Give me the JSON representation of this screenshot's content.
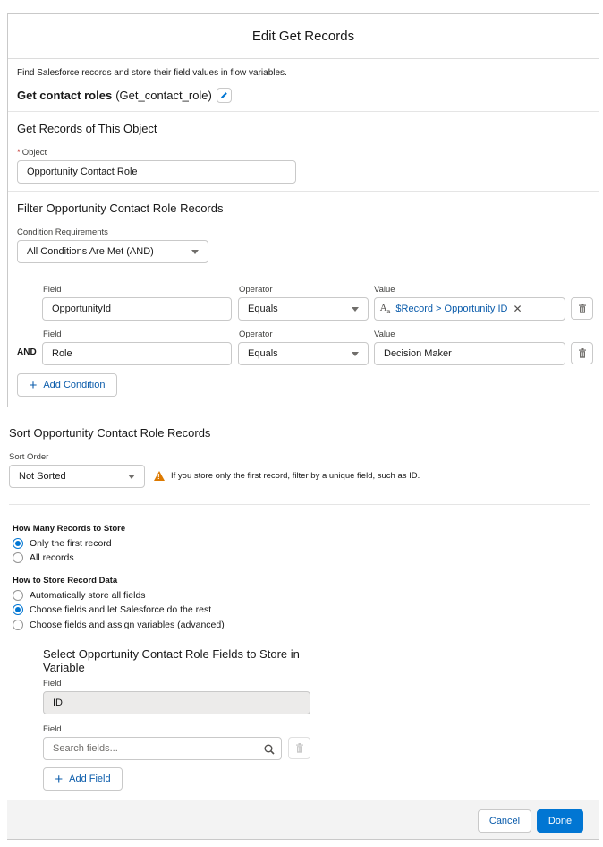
{
  "modal": {
    "title": "Edit Get Records",
    "description": "Find Salesforce records and store their field values in flow variables.",
    "element_label": "Get contact roles",
    "element_api_name": "(Get_contact_role)"
  },
  "object_section": {
    "title": "Get Records of This Object",
    "object_label": "Object",
    "object_value": "Opportunity Contact Role"
  },
  "filter_section": {
    "title": "Filter Opportunity Contact Role Records",
    "condition_requirements_label": "Condition Requirements",
    "condition_requirements_value": "All Conditions Are Met (AND)",
    "conditions": [
      {
        "field_label": "Field",
        "field_value": "OpportunityId",
        "operator_label": "Operator",
        "operator_value": "Equals",
        "value_label": "Value",
        "value_value": "$Record > Opportunity ID",
        "prefix": ""
      },
      {
        "field_label": "Field",
        "field_value": "Role",
        "operator_label": "Operator",
        "operator_value": "Equals",
        "value_label": "Value",
        "value_value": "Decision Maker",
        "prefix": "AND"
      }
    ],
    "add_condition_label": "Add Condition"
  },
  "sort_section": {
    "title": "Sort Opportunity Contact Role Records",
    "sort_order_label": "Sort Order",
    "sort_order_value": "Not Sorted",
    "warning": "If you store only the first record, filter by a unique field, such as ID."
  },
  "store_section": {
    "how_many_title": "How Many Records to Store",
    "how_many_options": [
      {
        "label": "Only the first record",
        "checked": true
      },
      {
        "label": "All records",
        "checked": false
      }
    ],
    "how_to_store_title": "How to Store Record Data",
    "how_to_store_options": [
      {
        "label": "Automatically store all fields",
        "checked": false
      },
      {
        "label": "Choose fields and let Salesforce do the rest",
        "checked": true
      },
      {
        "label": "Choose fields and assign variables (advanced)",
        "checked": false
      }
    ]
  },
  "fields_section": {
    "title": "Select Opportunity Contact Role Fields to Store in Variable",
    "field1_label": "Field",
    "field1_value": "ID",
    "field2_label": "Field",
    "field2_placeholder": "Search fields...",
    "add_field_label": "Add Field"
  },
  "footer": {
    "cancel_label": "Cancel",
    "done_label": "Done"
  },
  "colors": {
    "brand": "#0176d3",
    "link": "#0b5cab",
    "warning": "#dd7a01",
    "required": "#c23934"
  }
}
